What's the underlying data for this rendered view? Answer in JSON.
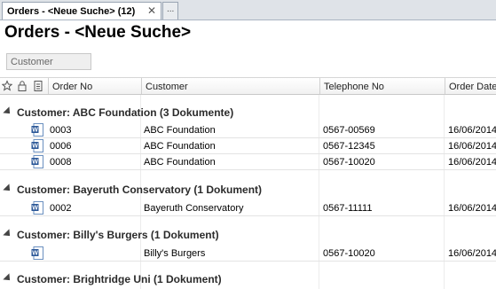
{
  "tabs": {
    "active_label": "Orders - <Neue Suche> (12)",
    "close_glyph": "✕",
    "more_label": "..."
  },
  "page": {
    "title": "Orders - <Neue Suche>"
  },
  "grouping": {
    "chip_label": "Customer"
  },
  "columns": {
    "order_no": "Order No",
    "customer": "Customer",
    "telephone": "Telephone No",
    "order_date": "Order Date"
  },
  "header_icons": [
    "star-icon",
    "lock-icon",
    "document-icon"
  ],
  "groups": [
    {
      "label": "Customer: ABC Foundation (3 Dokumente)",
      "rows": [
        {
          "order_no": "0003",
          "customer": "ABC Foundation",
          "telephone": "0567-00569",
          "date": "16/06/2014"
        },
        {
          "order_no": "0006",
          "customer": "ABC Foundation",
          "telephone": "0567-12345",
          "date": "16/06/2014"
        },
        {
          "order_no": "0008",
          "customer": "ABC Foundation",
          "telephone": "0567-10020",
          "date": "16/06/2014"
        }
      ]
    },
    {
      "label": "Customer: Bayeruth Conservatory (1 Dokument)",
      "rows": [
        {
          "order_no": "0002",
          "customer": "Bayeruth Conservatory",
          "telephone": "0567-11111",
          "date": "16/06/2014"
        }
      ]
    },
    {
      "label": "Customer: Billy's Burgers (1 Dokument)",
      "rows": [
        {
          "order_no": "",
          "customer": "Billy's Burgers",
          "telephone": "0567-10020",
          "date": "16/06/2014"
        }
      ]
    },
    {
      "label": "Customer: Brightridge Uni (1 Dokument)",
      "rows": []
    }
  ],
  "colors": {
    "word_icon": "#2b5797",
    "header_border": "#c8c8c8",
    "tab_border": "#9aa5b3"
  }
}
